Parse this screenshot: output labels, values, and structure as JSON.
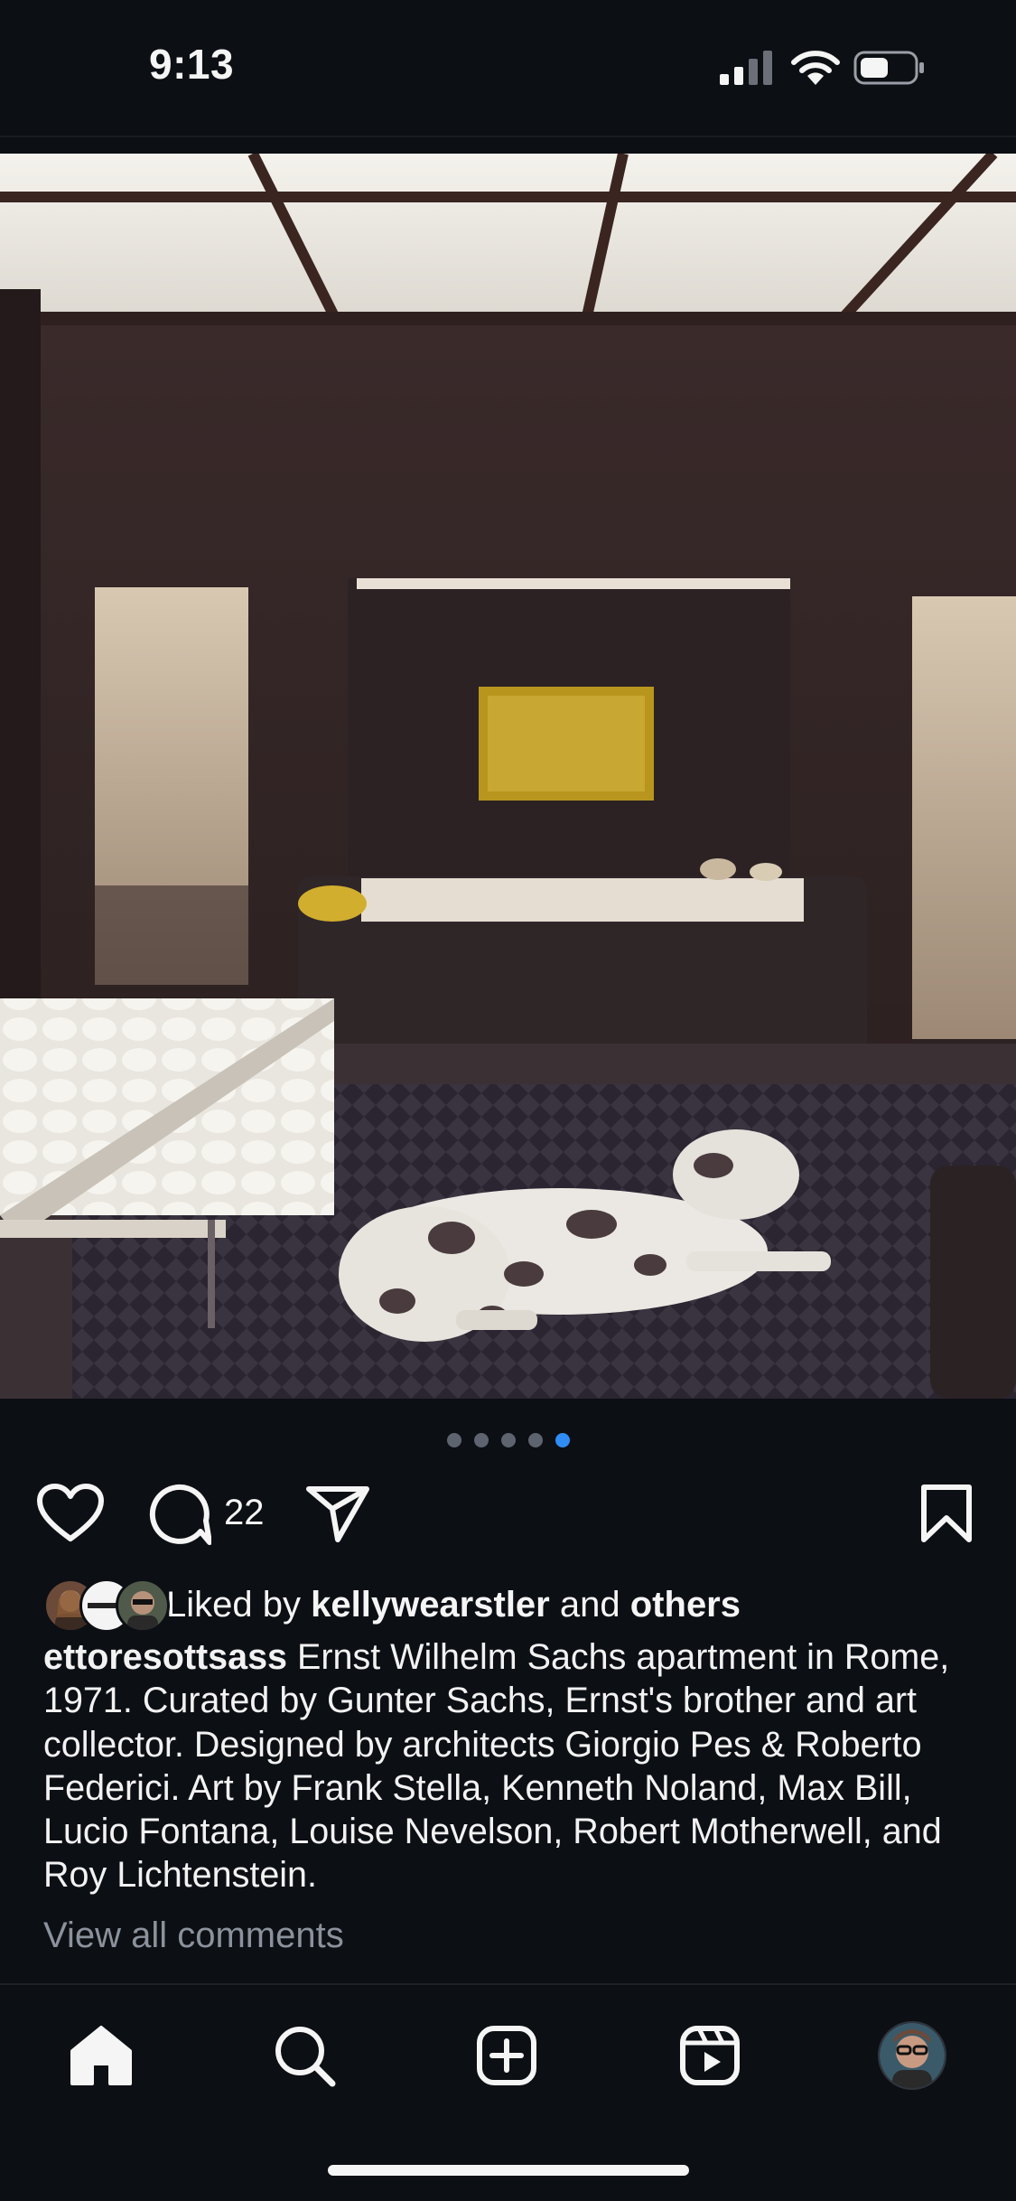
{
  "status_bar": {
    "time": "9:13",
    "signal_icon": "cellular-signal-icon",
    "wifi_icon": "wifi-icon",
    "battery_icon": "battery-icon"
  },
  "post": {
    "image_alt": "Ernst Wilhelm Sachs apartment interior with dog on rug",
    "carousel": {
      "total": 5,
      "active_index": 4
    },
    "actions": {
      "like_icon": "heart-icon",
      "comment_icon": "comment-bubble-icon",
      "comment_count": "22",
      "share_icon": "paper-plane-icon",
      "save_icon": "bookmark-icon"
    },
    "liked_by": {
      "prefix": "Liked by",
      "user": "kellywearstler",
      "joiner": "and",
      "others": "others"
    },
    "caption": {
      "username": "ettoresottsass",
      "text": "Ernst Wilhelm Sachs apartment in Rome, 1971. Curated by Gunter Sachs, Ernst's brother and art collector. Designed by architects Giorgio Pes & Roberto Federici. Art by Frank Stella, Kenneth Noland, Max Bill, Lucio Fontana, Louise Nevelson, Robert Motherwell, and Roy Lichtenstein."
    },
    "view_all_comments": "View all comments"
  },
  "tab_bar": {
    "items": [
      {
        "icon": "home-icon",
        "selected": true
      },
      {
        "icon": "search-icon",
        "selected": false
      },
      {
        "icon": "create-post-icon",
        "selected": false
      },
      {
        "icon": "reels-icon",
        "selected": false
      },
      {
        "icon": "profile-avatar",
        "selected": false
      }
    ]
  },
  "colors": {
    "background": "#0c0f14",
    "accent": "#2f8df5",
    "secondary_text": "#8b929c"
  }
}
